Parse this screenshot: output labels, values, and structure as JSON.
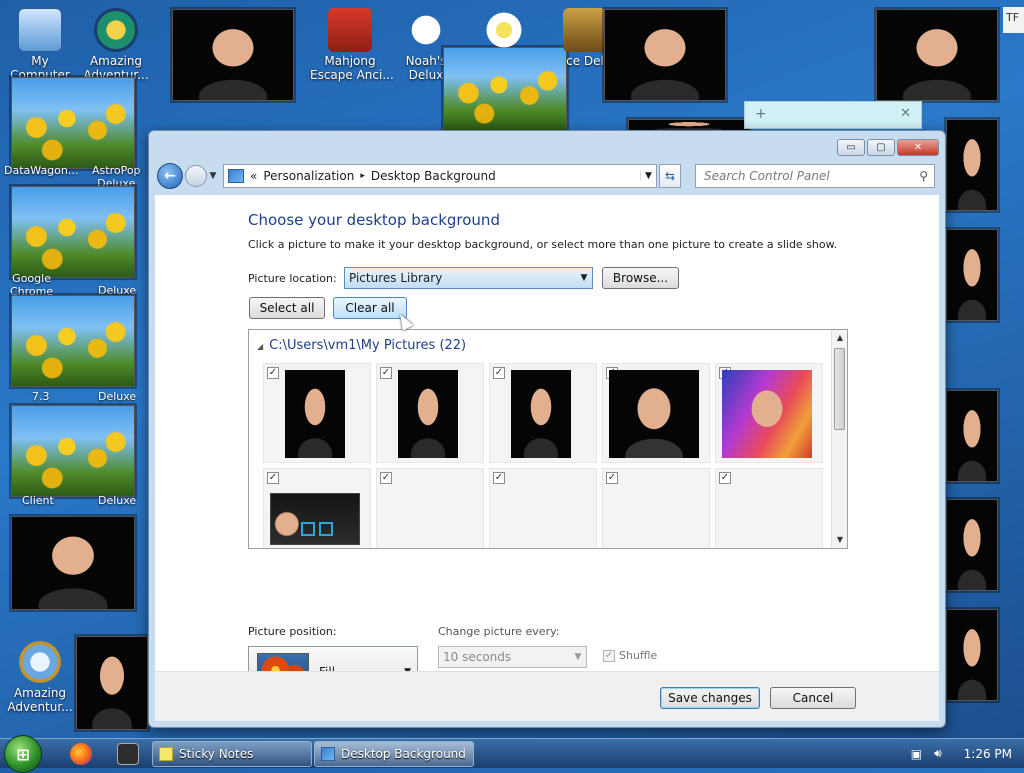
{
  "desktop": {
    "icons": [
      {
        "label": "My Computer"
      },
      {
        "label": "Amazing\nAdventur..."
      },
      {
        "label": "Mahjong\nEscape Anci..."
      },
      {
        "label": "Noah's\nDelux"
      },
      {
        "label": "ce Del"
      },
      {
        "label": "DataWagon..."
      },
      {
        "label": "AstroPop\nDeluxe"
      },
      {
        "label": "Google\nChrome"
      },
      {
        "label": "Deluxe"
      },
      {
        "label": "7.3"
      },
      {
        "label": "Deluxe"
      },
      {
        "label": "Client"
      },
      {
        "label": "Deluxe"
      },
      {
        "label": "Amazing\nAdventur..."
      },
      {
        "label": "TF"
      }
    ]
  },
  "window": {
    "title_controls": {
      "minimize": "▭",
      "maximize": "▢",
      "close": "✕"
    },
    "breadcrumb": {
      "prefix": "«",
      "items": [
        "Personalization",
        "Desktop Background"
      ],
      "separator": "▸"
    },
    "search_placeholder": "Search Control Panel",
    "heading": "Choose your desktop background",
    "subtext": "Click a picture to make it your desktop background, or select more than one picture to create a slide show.",
    "picture_location_label": "Picture location:",
    "picture_location_value": "Pictures Library",
    "browse_label": "Browse...",
    "select_all_label": "Select all",
    "clear_all_label": "Clear all",
    "gallery_header": "C:\\Users\\vm1\\My Pictures (22)",
    "picture_position_label": "Picture position:",
    "picture_position_value": "Fill",
    "change_every_label": "Change picture every:",
    "change_every_value": "10 seconds",
    "shuffle_label": "Shuffle",
    "save_label": "Save changes",
    "cancel_label": "Cancel"
  },
  "taskbar": {
    "buttons": [
      {
        "label": "Sticky Notes"
      },
      {
        "label": "Desktop Background"
      }
    ],
    "clock": "1:26 PM"
  },
  "colors": {
    "heading": "#1e3f8a",
    "accent": "#3c7fb1"
  }
}
